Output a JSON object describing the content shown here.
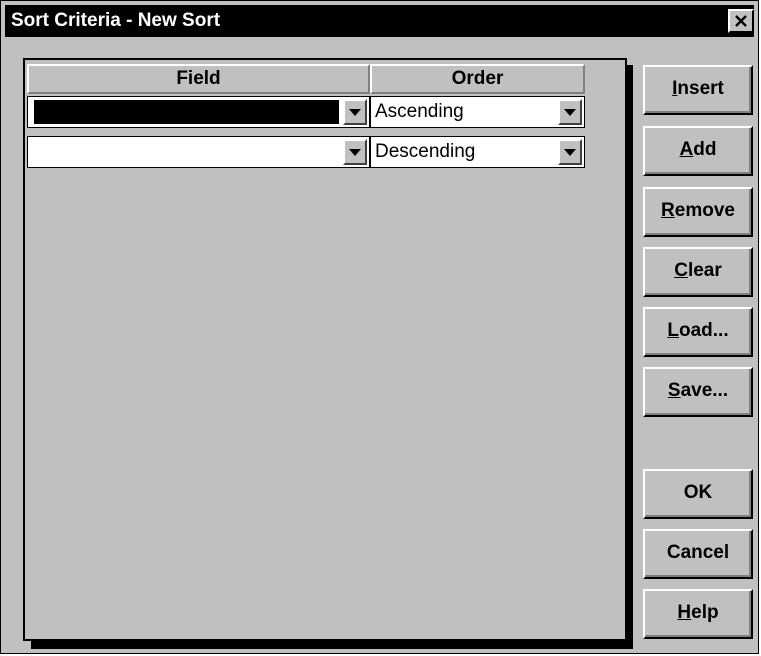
{
  "window": {
    "title": "Sort Criteria - New Sort"
  },
  "grid": {
    "columns": [
      "Field",
      "Order"
    ],
    "rows": [
      {
        "field": "",
        "field_selected": true,
        "order": "Ascending"
      },
      {
        "field": "",
        "field_selected": false,
        "order": "Descending"
      }
    ]
  },
  "buttons": {
    "insert": {
      "accel": "I",
      "rest": "nsert"
    },
    "add": {
      "accel": "A",
      "rest": "dd"
    },
    "remove": {
      "accel": "R",
      "rest": "emove"
    },
    "clear": {
      "accel": "C",
      "rest": "lear"
    },
    "load": {
      "accel": "L",
      "rest": "oad..."
    },
    "save": {
      "accel": "S",
      "rest": "ave..."
    },
    "ok": "OK",
    "cancel": "Cancel",
    "help": {
      "accel": "H",
      "rest": "elp"
    }
  },
  "icons": {
    "close": "close-icon",
    "dropdown": "chevron-down-icon"
  },
  "colors": {
    "titlebar": "#000000",
    "face": "#c0c0c0",
    "highlight": "#ffffff",
    "shadow": "#808080"
  }
}
